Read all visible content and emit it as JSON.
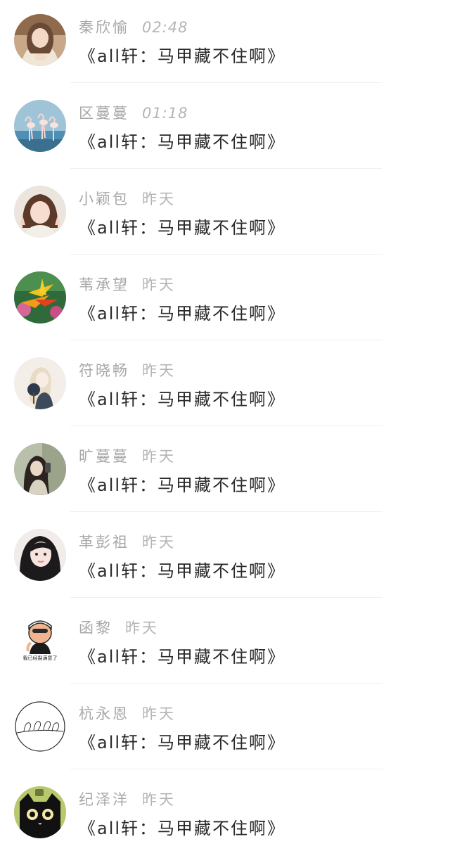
{
  "messages": [
    {
      "name": "秦欣愉",
      "time": "02:48",
      "text": "《all轩：马甲藏不住啊》",
      "avatar": "woman-sweater-photo"
    },
    {
      "name": "区蔓蔓",
      "time": "01:18",
      "text": "《all轩：马甲藏不住啊》",
      "avatar": "flamingos-photo"
    },
    {
      "name": "小颖包",
      "time": "昨天",
      "text": "《all轩：马甲藏不住啊》",
      "avatar": "girl-peace-sign-photo"
    },
    {
      "name": "苇承望",
      "time": "昨天",
      "text": "《all轩：马甲藏不住啊》",
      "avatar": "bird-of-paradise-flower-photo"
    },
    {
      "name": "符晓畅",
      "time": "昨天",
      "text": "《all轩：马甲藏不住啊》",
      "avatar": "illustrated-woman-fan"
    },
    {
      "name": "旷蔓蔓",
      "time": "昨天",
      "text": "《all轩：马甲藏不住啊》",
      "avatar": "woman-mirror-selfie-photo"
    },
    {
      "name": "革彭祖",
      "time": "昨天",
      "text": "《all轩：马甲藏不住啊》",
      "avatar": "girl-dark-hair-photo"
    },
    {
      "name": "函黎",
      "time": "昨天",
      "text": "《all轩：马甲藏不住啊》",
      "avatar": "cartoon-swimmer-sticker",
      "avatar_caption": "我已经裂满意了"
    },
    {
      "name": "杭永恩",
      "time": "昨天",
      "text": "《all轩：马甲藏不住啊》",
      "avatar": "line-art-birds-circle"
    },
    {
      "name": "纪泽洋",
      "time": "昨天",
      "text": "《all轩：马甲藏不住啊》",
      "avatar": "black-cat-cartoon"
    }
  ],
  "colors": {
    "name_text": "#a8a8a8",
    "time_text": "#b5b5b5",
    "message_text": "#2a2a2a",
    "divider": "#f0f0f0",
    "background": "#ffffff"
  }
}
